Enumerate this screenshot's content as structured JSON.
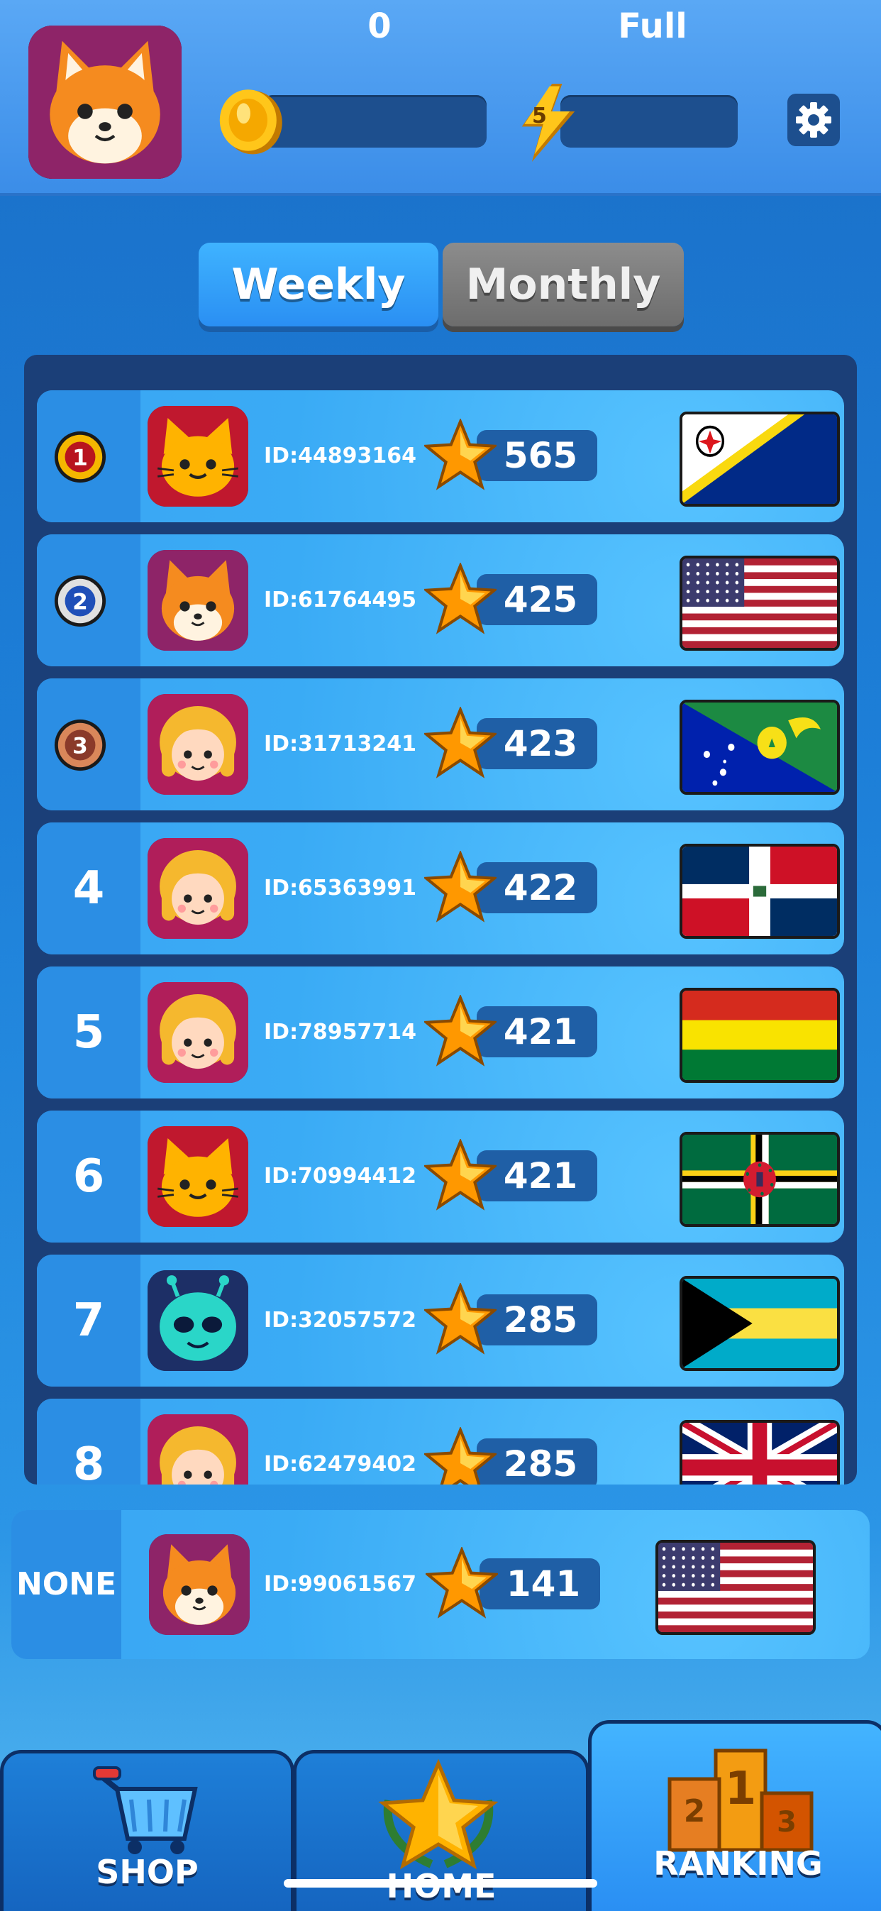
{
  "header": {
    "coins": "0",
    "energy_count": "5",
    "energy_status": "Full",
    "avatar_icon": "fox-avatar-icon",
    "settings_icon": "gear-icon"
  },
  "tabs": [
    {
      "label": "Weekly",
      "active": true
    },
    {
      "label": "Monthly",
      "active": false
    }
  ],
  "leaderboard": [
    {
      "rank": "1",
      "medal": "gold",
      "avatar": "cat",
      "id": "ID:44893164",
      "score": "565",
      "flag": "bonaire"
    },
    {
      "rank": "2",
      "medal": "silver",
      "avatar": "fox",
      "id": "ID:61764495",
      "score": "425",
      "flag": "usa"
    },
    {
      "rank": "3",
      "medal": "bronze",
      "avatar": "girl",
      "id": "ID:31713241",
      "score": "423",
      "flag": "christmas-island"
    },
    {
      "rank": "4",
      "medal": "",
      "avatar": "girl",
      "id": "ID:65363991",
      "score": "422",
      "flag": "dominican-republic"
    },
    {
      "rank": "5",
      "medal": "",
      "avatar": "girl",
      "id": "ID:78957714",
      "score": "421",
      "flag": "bolivia"
    },
    {
      "rank": "6",
      "medal": "",
      "avatar": "cat",
      "id": "ID:70994412",
      "score": "421",
      "flag": "dominica"
    },
    {
      "rank": "7",
      "medal": "",
      "avatar": "alien",
      "id": "ID:32057572",
      "score": "285",
      "flag": "bahamas"
    },
    {
      "rank": "8",
      "medal": "",
      "avatar": "girl",
      "id": "ID:62479402",
      "score": "285",
      "flag": "uk"
    }
  ],
  "current_user": {
    "rank": "NONE",
    "avatar": "fox",
    "id": "ID:99061567",
    "score": "141",
    "flag": "usa"
  },
  "nav": {
    "shop": "SHOP",
    "home": "HOME",
    "ranking": "RANKING",
    "podium_digits": [
      "2",
      "1",
      "3"
    ]
  },
  "colors": {
    "accent": "#2a8ff3",
    "panel": "#1b3f78",
    "coin": "#f5b700"
  }
}
